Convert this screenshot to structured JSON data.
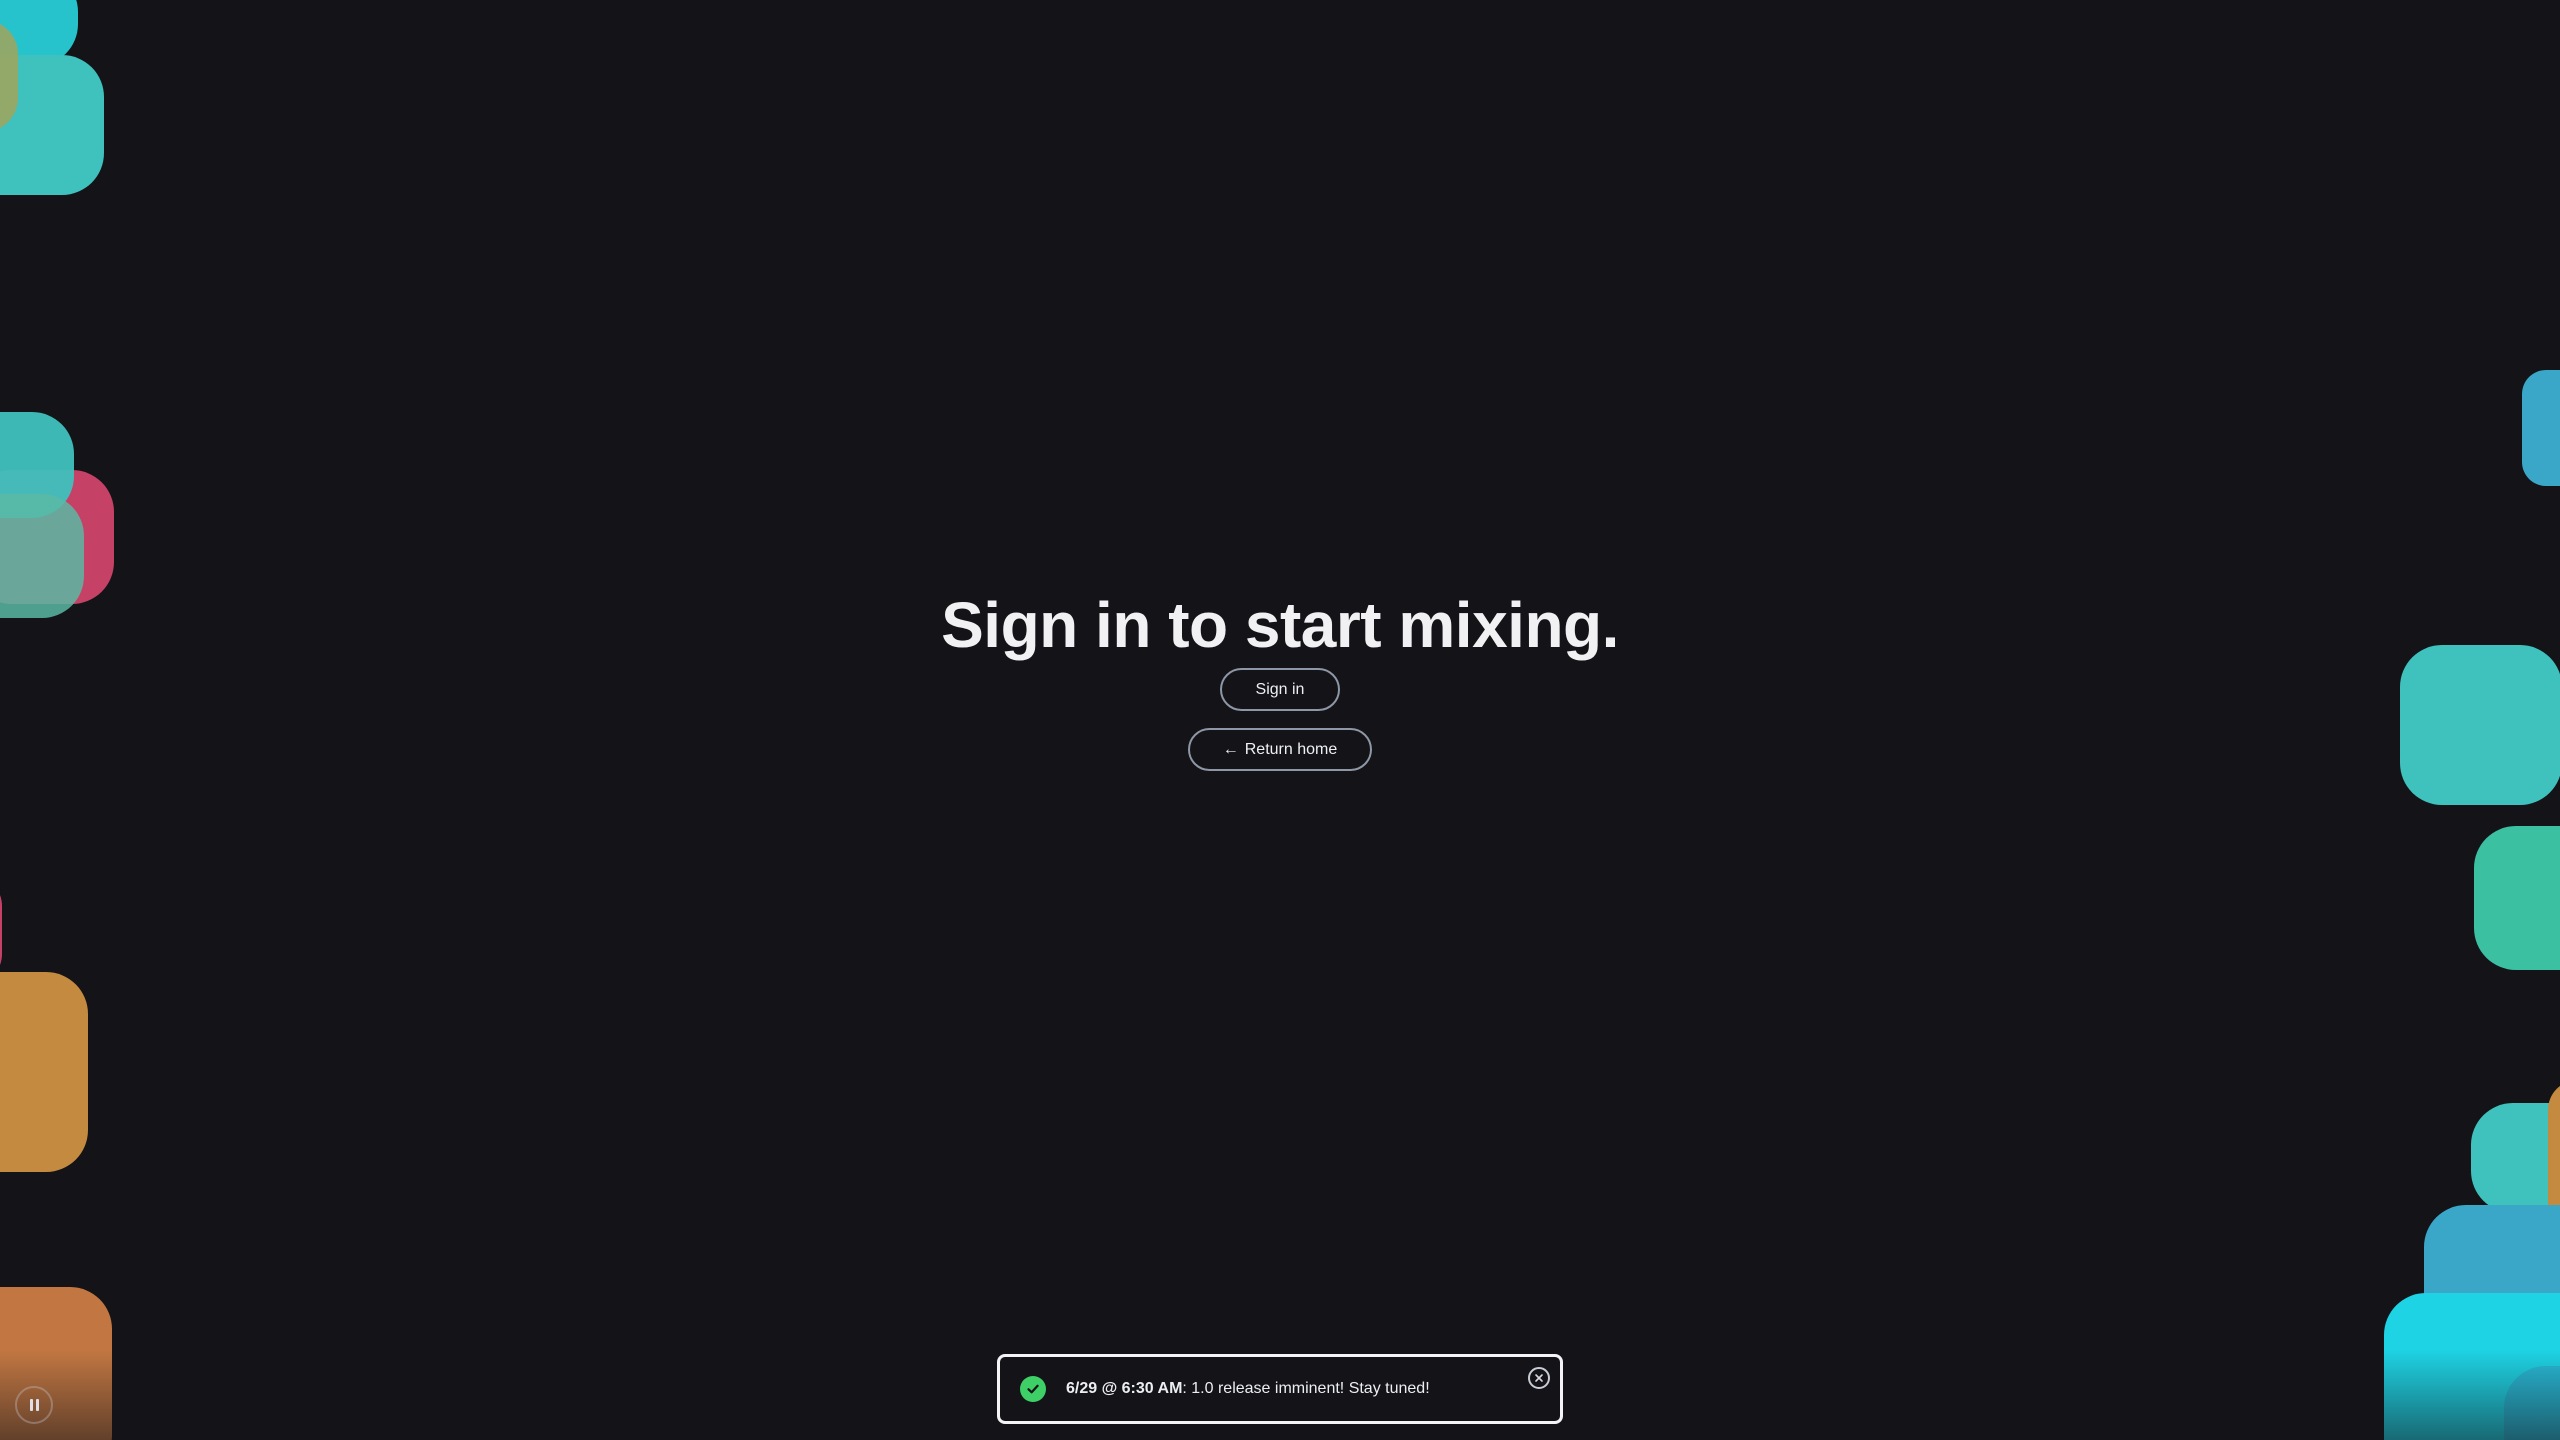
{
  "colors": {
    "background": "#131318",
    "tile_teal": "#3fc1bd",
    "tile_cyan": "#1ed3e4",
    "tile_blue": "#3aa7c8",
    "tile_green": "#3cc0a2",
    "tile_orange": "#c38a40",
    "tile_burnt_orange": "#c27742",
    "tile_pink": "#c64166",
    "tile_olive": "#a2a55a",
    "toast_check": "#3ecf66"
  },
  "main": {
    "headline": "Sign in to start mixing.",
    "sign_in_label": "Sign in",
    "return_home_arrow": "←",
    "return_home_label": "Return home"
  },
  "toast": {
    "icon": "check-circle-icon",
    "timestamp": "6/29 @ 6:30 AM",
    "message": ": 1.0 release imminent! Stay tuned!",
    "close_icon": "close-icon"
  },
  "animation_control": {
    "icon": "pause-icon"
  }
}
